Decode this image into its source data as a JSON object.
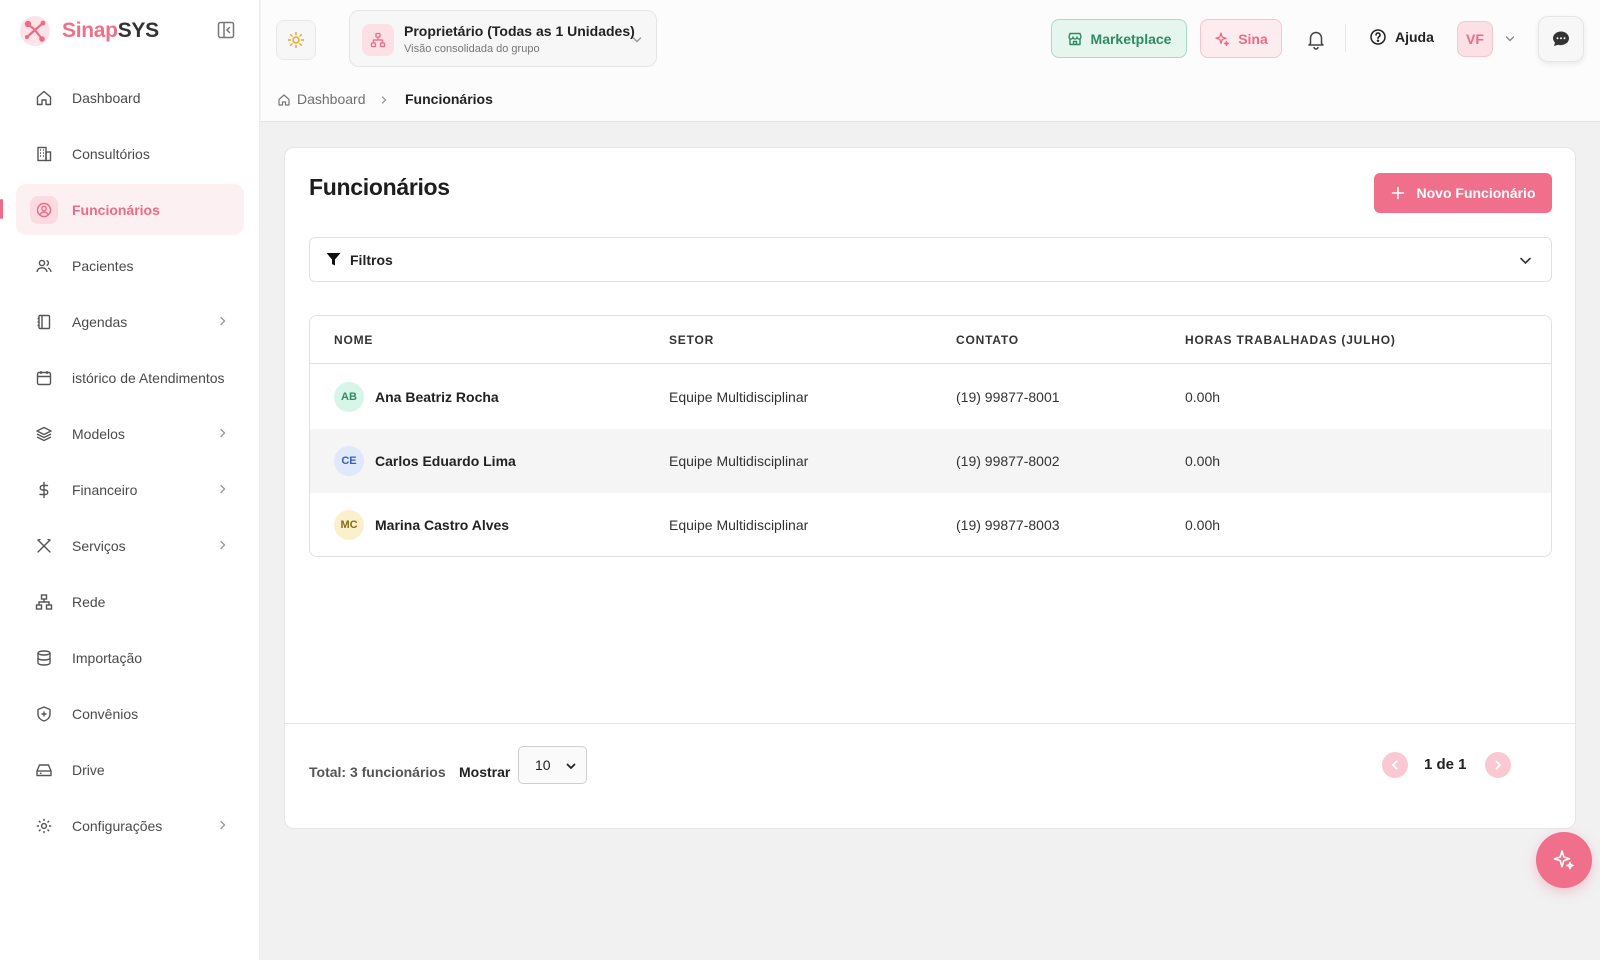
{
  "brand": {
    "name_part1": "Sinap",
    "name_part2": "SYS"
  },
  "sidebar": {
    "items": [
      {
        "label": "Dashboard",
        "icon": "home-icon"
      },
      {
        "label": "Consultórios",
        "icon": "building-icon"
      },
      {
        "label": "Funcionários",
        "icon": "user-circle-icon",
        "active": true
      },
      {
        "label": "Pacientes",
        "icon": "users-icon"
      },
      {
        "label": "Agendas",
        "icon": "book-icon",
        "has_submenu": true
      },
      {
        "label": "istórico de Atendimentos",
        "icon": "calendar-icon"
      },
      {
        "label": "Modelos",
        "icon": "layers-icon",
        "has_submenu": true
      },
      {
        "label": "Financeiro",
        "icon": "dollar-icon",
        "has_submenu": true
      },
      {
        "label": "Serviços",
        "icon": "tools-icon",
        "has_submenu": true
      },
      {
        "label": "Rede",
        "icon": "network-icon"
      },
      {
        "label": "Importação",
        "icon": "database-icon"
      },
      {
        "label": "Convênios",
        "icon": "shield-icon"
      },
      {
        "label": "Drive",
        "icon": "drive-icon"
      },
      {
        "label": "Configurações",
        "icon": "gear-icon",
        "has_submenu": true
      }
    ]
  },
  "topbar": {
    "org_title": "Proprietário (Todas as 1 Unidades)",
    "org_subtitle": "Visão consolidada do grupo",
    "marketplace_label": "Marketplace",
    "sina_label": "Sina",
    "help_label": "Ajuda",
    "user_initials": "VF"
  },
  "breadcrumb": {
    "root": "Dashboard",
    "current": "Funcionários"
  },
  "main": {
    "title": "Funcionários",
    "new_button_label": "Novo Funcionário",
    "filters_label": "Filtros",
    "table": {
      "headers": [
        "NOME",
        "SETOR",
        "CONTATO",
        "HORAS TRABALHADAS (JULHO)"
      ],
      "rows": [
        {
          "initials": "AB",
          "name": "Ana Beatriz Rocha",
          "setor": "Equipe Multidisciplinar",
          "contato": "(19) 99877-8001",
          "horas": "0.00h",
          "avatar_bg": "#d8f5ea",
          "avatar_fg": "#2e8b62"
        },
        {
          "initials": "CE",
          "name": "Carlos Eduardo Lima",
          "setor": "Equipe Multidisciplinar",
          "contato": "(19) 99877-8002",
          "horas": "0.00h",
          "avatar_bg": "#dfe9fb",
          "avatar_fg": "#3a63b5"
        },
        {
          "initials": "MC",
          "name": "Marina Castro Alves",
          "setor": "Equipe Multidisciplinar",
          "contato": "(19) 99877-8003",
          "horas": "0.00h",
          "avatar_bg": "#fbf0cc",
          "avatar_fg": "#8a6a10"
        }
      ]
    },
    "footer": {
      "total_label": "Total: 3 funcionários",
      "show_label": "Mostrar",
      "per_page": "10",
      "pagination": "1 de 1"
    }
  },
  "colors": {
    "accent": "#f06f8a",
    "marketplace": "#2e8b62"
  }
}
